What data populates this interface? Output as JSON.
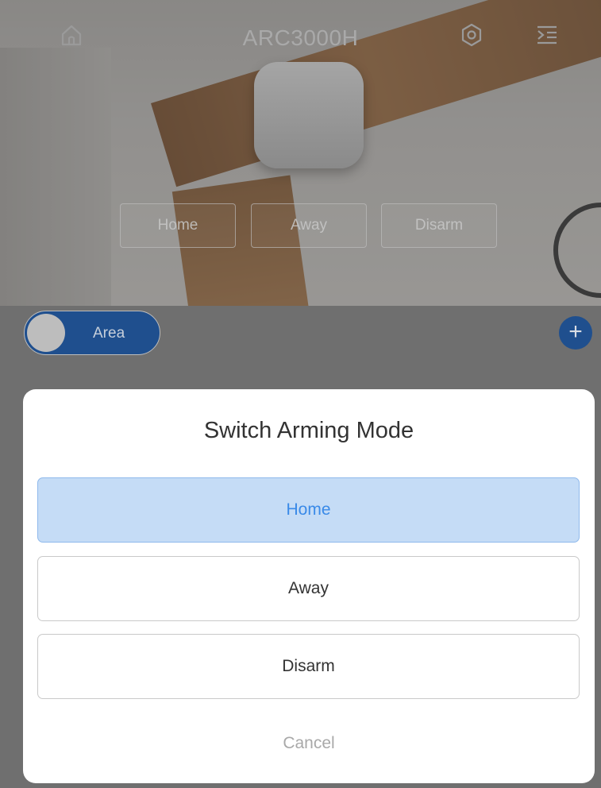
{
  "header": {
    "title": "ARC3000H",
    "icons": {
      "home": "home-icon",
      "settings": "hexagon-settings-icon",
      "menu": "menu-list-icon"
    }
  },
  "hero": {
    "mode_buttons": [
      "Home",
      "Away",
      "Disarm"
    ]
  },
  "area": {
    "toggle_label": "Area",
    "add_icon": "plus-icon",
    "add_label": "+"
  },
  "dialog": {
    "title": "Switch Arming Mode",
    "options": [
      {
        "label": "Home",
        "selected": true
      },
      {
        "label": "Away",
        "selected": false
      },
      {
        "label": "Disarm",
        "selected": false
      }
    ],
    "cancel_label": "Cancel"
  },
  "colors": {
    "accent": "#3a8ae8",
    "selected_bg": "#c5dcf6",
    "toggle_blue": "#1f4f8e"
  }
}
